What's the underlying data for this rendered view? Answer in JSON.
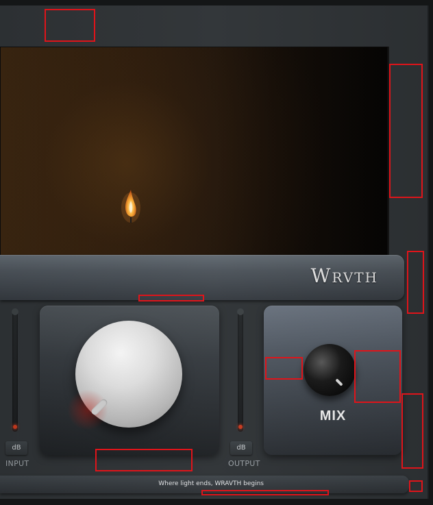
{
  "brand": {
    "name": "Wrvth"
  },
  "meters": {
    "input": {
      "label": "INPUT",
      "unit_button": "dB"
    },
    "output": {
      "label": "OUTPUT",
      "unit_button": "dB"
    }
  },
  "mix": {
    "label": "MIX"
  },
  "footer": {
    "tagline": "Where light ends, WRAVTH begins"
  },
  "colors": {
    "panel": "#2f3336",
    "accent_red": "#c83a1e",
    "marker": "#e0141a"
  },
  "icons": {
    "visual": "candle-flame-icon"
  }
}
